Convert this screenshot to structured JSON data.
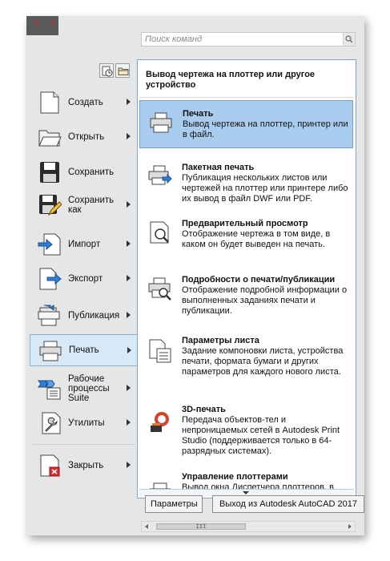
{
  "search": {
    "placeholder": "Поиск команд"
  },
  "menu": {
    "items": [
      {
        "label": "Создать"
      },
      {
        "label": "Открыть"
      },
      {
        "label": "Сохранить"
      },
      {
        "label": "Сохранить как"
      },
      {
        "label": "Импорт"
      },
      {
        "label": "Экспорт"
      },
      {
        "label": "Публикация"
      },
      {
        "label": "Печать"
      },
      {
        "label": "Рабочие процессы Suite"
      },
      {
        "label": "Утилиты"
      },
      {
        "label": "Закрыть"
      }
    ],
    "selected": "Печать"
  },
  "panel": {
    "header": "Вывод чертежа на плоттер или другое устройство",
    "entries": [
      {
        "title": "Печать",
        "desc": "Вывод чертежа на плоттер, принтер или в файл.",
        "icon": "printer-icon"
      },
      {
        "title": "Пакетная печать",
        "desc": "Публикация нескольких листов или чертежей на плоттер или принтере либо их вывод в файл DWF или PDF.",
        "icon": "batch-print-icon"
      },
      {
        "title": "Предварительный просмотр",
        "desc": "Отображение чертежа в том виде, в каком он будет выведен на печать.",
        "icon": "preview-icon"
      },
      {
        "title": "Подробности о печати/публикации",
        "desc": "Отображение подробной информации о выполненных заданиях печати и публикации.",
        "icon": "print-details-icon"
      },
      {
        "title": "Параметры листа",
        "desc": "Задание компоновки листа, устройства печати, формата бумаги и других параметров для каждого нового листа.",
        "icon": "page-setup-icon"
      },
      {
        "title": "3D-печать",
        "desc": "Передача объектов-тел и непроницаемых сетей в Autodesk Print Studio (поддерживается только в 64-разрядных системах).",
        "icon": "3d-print-icon"
      },
      {
        "title": "Управление плоттерами",
        "desc": "Вывод окна Диспетчера плоттеров, в",
        "icon": "plotter-manager-icon"
      }
    ]
  },
  "buttons": {
    "options": "Параметры",
    "exit": "Выход из Autodesk AutoCAD 2017"
  },
  "scrollbar": {
    "thumb_label": "III"
  }
}
